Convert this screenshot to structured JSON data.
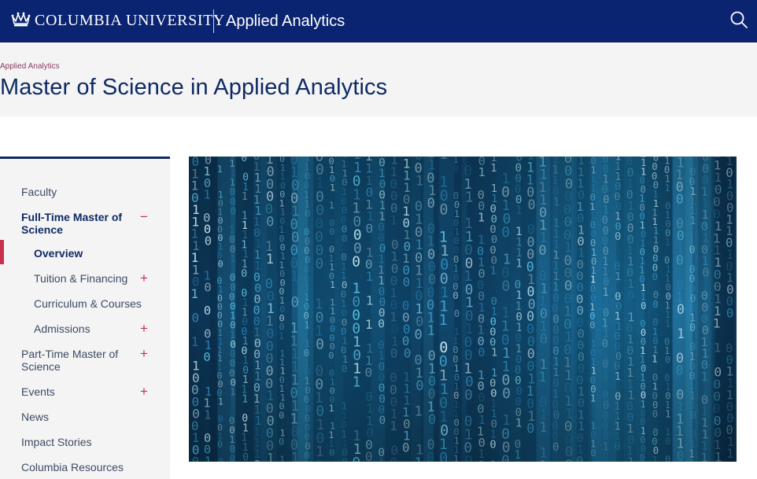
{
  "header": {
    "university": "COLUMBIA UNIVERSITY",
    "site_name": "Applied Analytics",
    "search_icon": "search-icon",
    "logo_icon": "crown-icon",
    "background": "#0b2471"
  },
  "breadcrumb": "Applied Analytics",
  "page_title": "Master of Science in Applied Analytics",
  "sidebar": {
    "items": [
      {
        "label": "Faculty",
        "level": 1,
        "toggle": ""
      },
      {
        "label": "Full-Time Master of Science",
        "level": 1,
        "toggle": "−",
        "expanded": true
      },
      {
        "label": "Overview",
        "level": 2,
        "toggle": "",
        "active": true
      },
      {
        "label": "Tuition & Financing",
        "level": 2,
        "toggle": "+"
      },
      {
        "label": "Curriculum & Courses",
        "level": 2,
        "toggle": ""
      },
      {
        "label": "Admissions",
        "level": 2,
        "toggle": "+"
      },
      {
        "label": "Part-Time Master of Science",
        "level": 1,
        "toggle": "+"
      },
      {
        "label": "Events",
        "level": 1,
        "toggle": "+"
      },
      {
        "label": "News",
        "level": 1,
        "toggle": ""
      },
      {
        "label": "Impact Stories",
        "level": 1,
        "toggle": ""
      },
      {
        "label": "Columbia Resources",
        "level": 1,
        "toggle": ""
      }
    ],
    "accent_color": "#c6304a"
  },
  "hero": {
    "image": "binary-code-rain-image",
    "accent_color": "#3fb4e8"
  }
}
